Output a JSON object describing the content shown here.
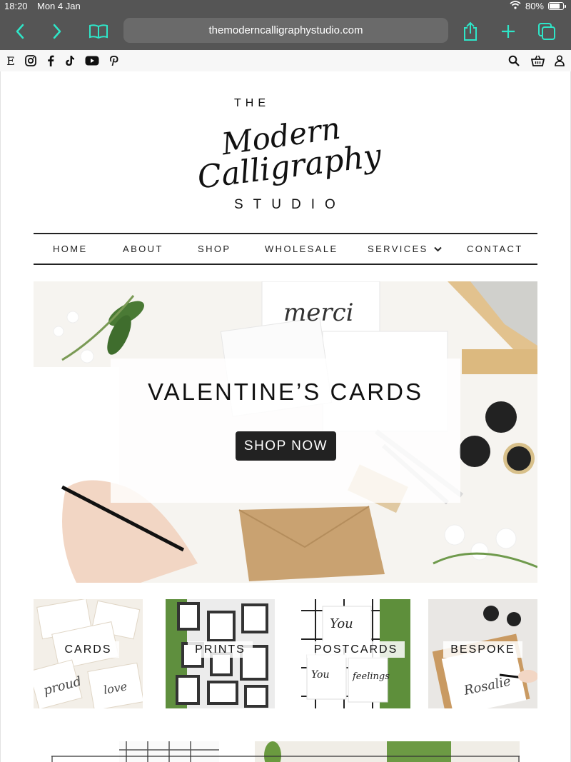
{
  "status_bar": {
    "time": "18:20",
    "date": "Mon 4 Jan",
    "battery": "80%",
    "battery_level": 0.8
  },
  "browser": {
    "url": "themoderncalligraphystudio.com",
    "accent_color": "#2ee6c8"
  },
  "social_icons": [
    "etsy-icon",
    "instagram-icon",
    "facebook-icon",
    "tiktok-icon",
    "youtube-icon",
    "pinterest-icon"
  ],
  "utility_icons": [
    "search-icon",
    "basket-icon",
    "account-icon"
  ],
  "logo": {
    "line1": "THE",
    "line2": "Modern",
    "line3": "Calligraphy",
    "line4": "STUDIO"
  },
  "nav": {
    "home": "HOME",
    "about": "ABOUT",
    "shop": "SHOP",
    "wholesale": "WHOLESALE",
    "services": "SERVICES",
    "contact": "CONTACT"
  },
  "hero": {
    "title": "VALENTINE’S CARDS",
    "button": "SHOP NOW"
  },
  "tiles": [
    {
      "label": "CARDS"
    },
    {
      "label": "PRINTS"
    },
    {
      "label": "POSTCARDS"
    },
    {
      "label": "BESPOKE"
    }
  ]
}
